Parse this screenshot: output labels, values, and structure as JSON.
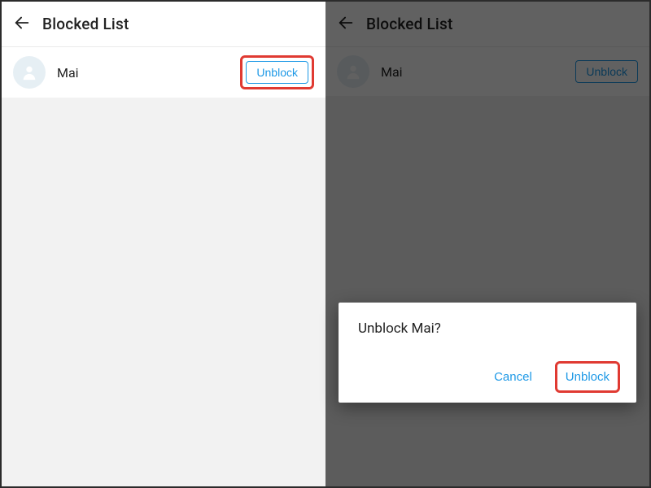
{
  "header": {
    "title": "Blocked List"
  },
  "blocked": {
    "items": [
      {
        "name": "Mai",
        "action": "Unblock"
      }
    ]
  },
  "dialog": {
    "title": "Unblock Mai?",
    "cancel": "Cancel",
    "confirm": "Unblock"
  },
  "colors": {
    "accent": "#1e99e6",
    "highlight": "#e03a32"
  }
}
